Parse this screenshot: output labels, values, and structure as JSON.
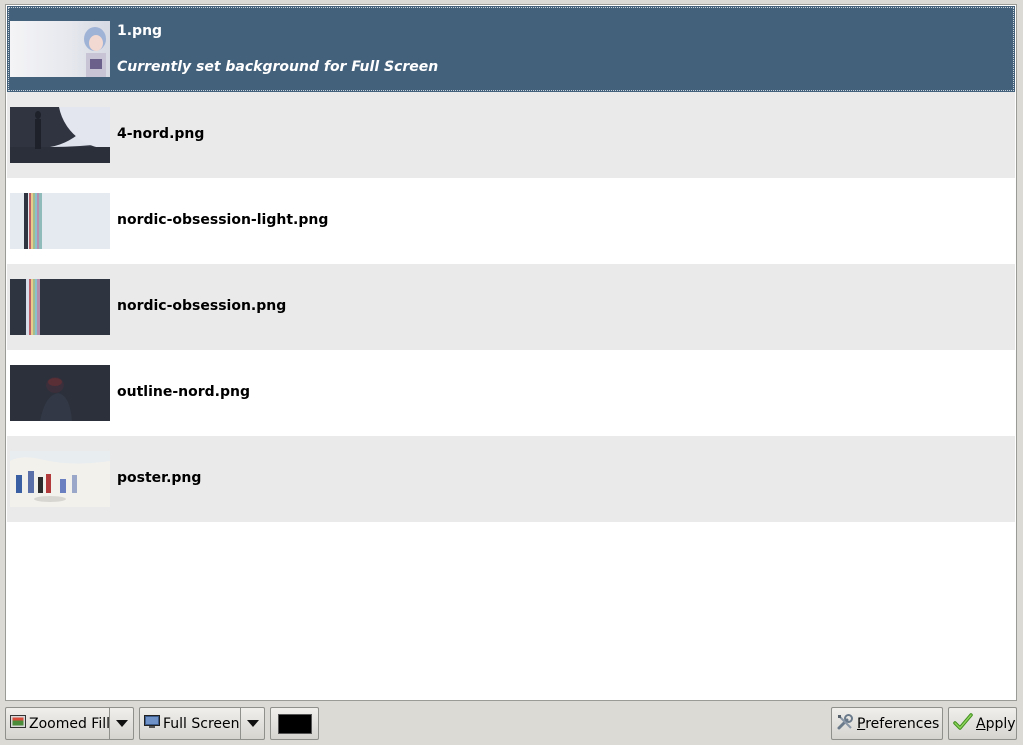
{
  "list": {
    "items": [
      {
        "name": "1.png",
        "subtitle": "Currently set background for Full Screen",
        "selected": true
      },
      {
        "name": "4-nord.png"
      },
      {
        "name": "nordic-obsession-light.png"
      },
      {
        "name": "nordic-obsession.png"
      },
      {
        "name": "outline-nord.png"
      },
      {
        "name": "poster.png"
      }
    ]
  },
  "toolbar": {
    "mode_value": "Zoomed Fill",
    "monitor_value": "Full Screen",
    "color_value": "#000000",
    "preferences_label_first": "P",
    "preferences_label_rest": "references",
    "apply_label_first": "A",
    "apply_label_rest": "pply"
  }
}
